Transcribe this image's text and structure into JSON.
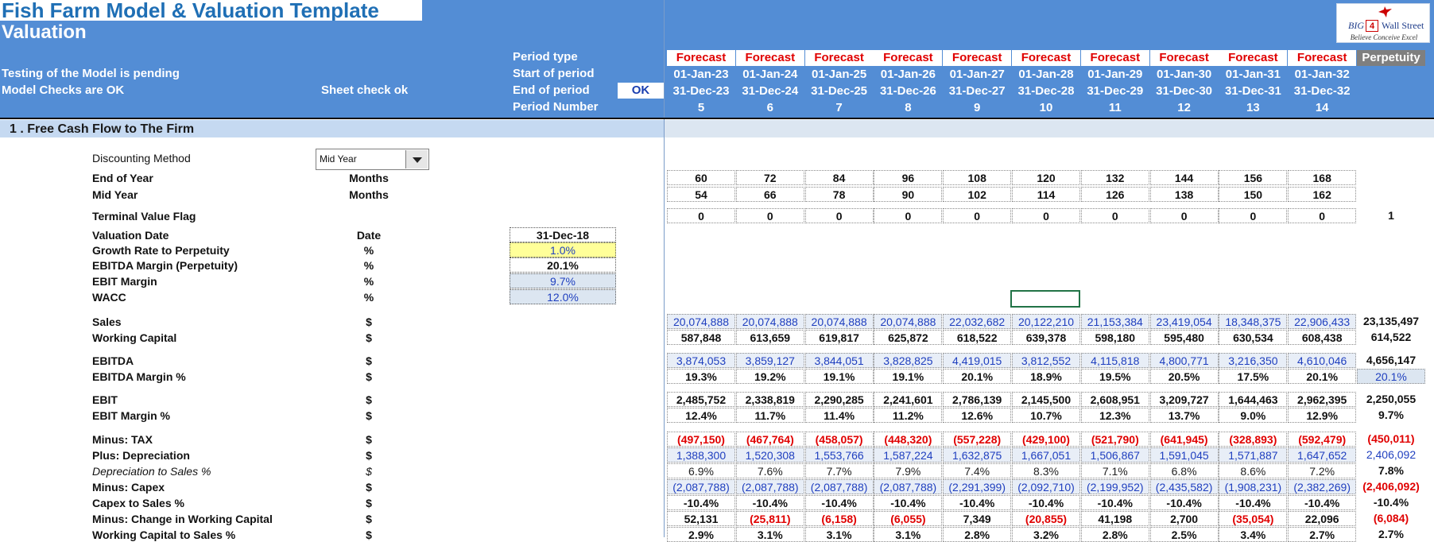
{
  "header": {
    "title": "Fish Farm Model & Valuation Template",
    "subtitle": "Valuation",
    "status_testing": "Testing of the Model is pending",
    "status_checks": "Model Checks are OK",
    "sheet_check": "Sheet check ok",
    "ok_label": "OK",
    "row_labels": {
      "period_type": "Period type",
      "start": "Start of period",
      "end": "End of period",
      "number": "Period Number"
    },
    "logo": {
      "big": "BIG",
      "num": "4",
      "ws": "Wall Street",
      "tagline": "Believe Conceive Excel"
    }
  },
  "periods": [
    {
      "type": "Forecast",
      "start": "01-Jan-23",
      "end": "31-Dec-23",
      "num": "5"
    },
    {
      "type": "Forecast",
      "start": "01-Jan-24",
      "end": "31-Dec-24",
      "num": "6"
    },
    {
      "type": "Forecast",
      "start": "01-Jan-25",
      "end": "31-Dec-25",
      "num": "7"
    },
    {
      "type": "Forecast",
      "start": "01-Jan-26",
      "end": "31-Dec-26",
      "num": "8"
    },
    {
      "type": "Forecast",
      "start": "01-Jan-27",
      "end": "31-Dec-27",
      "num": "9"
    },
    {
      "type": "Forecast",
      "start": "01-Jan-28",
      "end": "31-Dec-28",
      "num": "10"
    },
    {
      "type": "Forecast",
      "start": "01-Jan-29",
      "end": "31-Dec-29",
      "num": "11"
    },
    {
      "type": "Forecast",
      "start": "01-Jan-30",
      "end": "31-Dec-30",
      "num": "12"
    },
    {
      "type": "Forecast",
      "start": "01-Jan-31",
      "end": "31-Dec-31",
      "num": "13"
    },
    {
      "type": "Forecast",
      "start": "01-Jan-32",
      "end": "31-Dec-32",
      "num": "14"
    },
    {
      "type": "Perpetuity",
      "start": "",
      "end": "",
      "num": ""
    }
  ],
  "section": {
    "title": "1 . Free Cash Flow to The Firm"
  },
  "discounting": {
    "label": "Discounting Method",
    "value": "Mid Year"
  },
  "inputs": [
    {
      "label": "Valuation Date",
      "unit": "Date",
      "value": "31-Dec-18",
      "style": "k"
    },
    {
      "label": "Growth Rate to Perpetuity",
      "unit": "%",
      "value": "1.0%",
      "style": "yl"
    },
    {
      "label": "EBITDA Margin (Perpetuity)",
      "unit": "%",
      "value": "20.1%",
      "style": "k"
    },
    {
      "label": "EBIT Margin",
      "unit": "%",
      "value": "9.7%",
      "style": "lb"
    },
    {
      "label": "WACC",
      "unit": "%",
      "value": "12.0%",
      "style": "lb"
    }
  ],
  "rows": [
    {
      "label": "End of Year",
      "unit": "Months",
      "style": "k",
      "values": [
        "60",
        "72",
        "84",
        "96",
        "108",
        "120",
        "132",
        "144",
        "156",
        "168",
        ""
      ]
    },
    {
      "label": "Mid Year",
      "unit": "Months",
      "style": "k",
      "values": [
        "54",
        "66",
        "78",
        "90",
        "102",
        "114",
        "126",
        "138",
        "150",
        "162",
        ""
      ]
    },
    {
      "label": "Terminal Value Flag",
      "unit": "",
      "style": "k",
      "values": [
        "0",
        "0",
        "0",
        "0",
        "0",
        "0",
        "0",
        "0",
        "0",
        "0",
        "1"
      ]
    },
    {
      "label": "Sales",
      "unit": "$",
      "style": "bl",
      "values": [
        "20,074,888",
        "20,074,888",
        "20,074,888",
        "20,074,888",
        "22,032,682",
        "20,122,210",
        "21,153,384",
        "23,419,054",
        "18,348,375",
        "22,906,433",
        "23,135,497"
      ]
    },
    {
      "label": "Working Capital",
      "unit": "$",
      "style": "k",
      "values": [
        "587,848",
        "613,659",
        "619,817",
        "625,872",
        "618,522",
        "639,378",
        "598,180",
        "595,480",
        "630,534",
        "608,438",
        "614,522"
      ]
    },
    {
      "label": "EBITDA",
      "unit": "$",
      "style": "bl",
      "values": [
        "3,874,053",
        "3,859,127",
        "3,844,051",
        "3,828,825",
        "4,419,015",
        "3,812,552",
        "4,115,818",
        "4,800,771",
        "3,216,350",
        "4,610,046",
        "4,656,147"
      ]
    },
    {
      "label": "EBITDA Margin %",
      "unit": "$",
      "style": "k",
      "values": [
        "19.3%",
        "19.2%",
        "19.1%",
        "19.1%",
        "20.1%",
        "18.9%",
        "19.5%",
        "20.5%",
        "17.5%",
        "20.1%",
        "20.1%"
      ]
    },
    {
      "label": "EBIT",
      "unit": "$",
      "style": "k",
      "values": [
        "2,485,752",
        "2,338,819",
        "2,290,285",
        "2,241,601",
        "2,786,139",
        "2,145,500",
        "2,608,951",
        "3,209,727",
        "1,644,463",
        "2,962,395",
        "2,250,055"
      ]
    },
    {
      "label": "EBIT Margin %",
      "unit": "$",
      "style": "k",
      "values": [
        "12.4%",
        "11.7%",
        "11.4%",
        "11.2%",
        "12.6%",
        "10.7%",
        "12.3%",
        "13.7%",
        "9.0%",
        "12.9%",
        "9.7%"
      ]
    },
    {
      "label": "Minus: TAX",
      "unit": "$",
      "style": "rd",
      "values": [
        "(497,150)",
        "(467,764)",
        "(458,057)",
        "(448,320)",
        "(557,228)",
        "(429,100)",
        "(521,790)",
        "(641,945)",
        "(328,893)",
        "(592,479)",
        "(450,011)"
      ]
    },
    {
      "label": "Plus: Depreciation",
      "unit": "$",
      "style": "bl",
      "values": [
        "1,388,300",
        "1,520,308",
        "1,553,766",
        "1,587,224",
        "1,632,875",
        "1,667,051",
        "1,506,867",
        "1,591,045",
        "1,571,887",
        "1,647,652",
        "2,406,092"
      ]
    },
    {
      "label": "Depreciation to Sales %",
      "unit": "$",
      "style": "gr",
      "values": [
        "6.9%",
        "7.6%",
        "7.7%",
        "7.9%",
        "7.4%",
        "8.3%",
        "7.1%",
        "6.8%",
        "8.6%",
        "7.2%",
        "7.8%"
      ]
    },
    {
      "label": "Minus: Capex",
      "unit": "$",
      "style": "bl",
      "values": [
        "(2,087,788)",
        "(2,087,788)",
        "(2,087,788)",
        "(2,087,788)",
        "(2,291,399)",
        "(2,092,710)",
        "(2,199,952)",
        "(2,435,582)",
        "(1,908,231)",
        "(2,382,269)",
        "(2,406,092)"
      ]
    },
    {
      "label": "Capex to Sales %",
      "unit": "$",
      "style": "k",
      "values": [
        "-10.4%",
        "-10.4%",
        "-10.4%",
        "-10.4%",
        "-10.4%",
        "-10.4%",
        "-10.4%",
        "-10.4%",
        "-10.4%",
        "-10.4%",
        "-10.4%"
      ]
    },
    {
      "label": "Minus: Change in Working Capital",
      "unit": "$",
      "style": "mix",
      "values": [
        "52,131",
        "(25,811)",
        "(6,158)",
        "(6,055)",
        "7,349",
        "(20,855)",
        "41,198",
        "2,700",
        "(35,054)",
        "22,096",
        "(6,084)"
      ]
    },
    {
      "label": "Working Capital to Sales %",
      "unit": "$",
      "style": "k",
      "values": [
        "2.9%",
        "3.1%",
        "3.1%",
        "3.1%",
        "2.8%",
        "3.2%",
        "2.8%",
        "2.5%",
        "3.4%",
        "2.7%",
        "2.7%"
      ]
    }
  ],
  "colors": {
    "header_bg": "#538dd5",
    "forecast_text": "#e00000",
    "input_blue": "#1f3fbf",
    "section_bg": "#c5d9f1"
  }
}
